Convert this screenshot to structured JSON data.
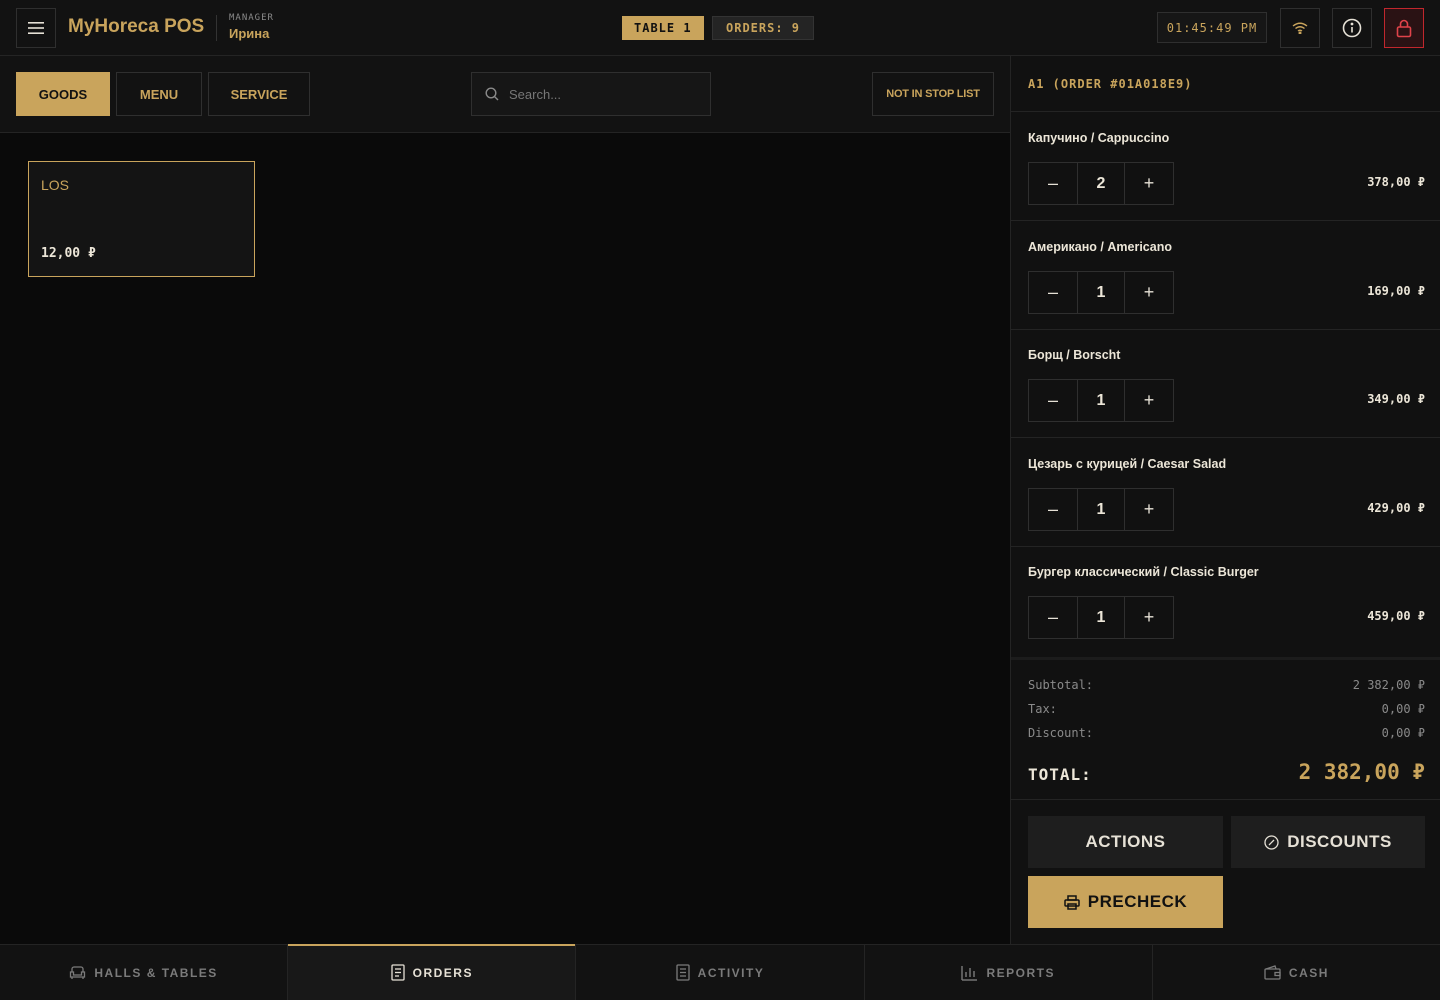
{
  "header": {
    "brand": "MyHoreca POS",
    "role": "MANAGER",
    "user": "Ирина",
    "table_badge": "TABLE 1",
    "orders_badge": "ORDERS: 9",
    "clock": "01:45:49 PM"
  },
  "toolbar": {
    "tabs": [
      {
        "label": "GOODS",
        "active": true
      },
      {
        "label": "MENU",
        "active": false
      },
      {
        "label": "SERVICE",
        "active": false
      }
    ],
    "search_placeholder": "Search...",
    "stoplist_label": "NOT IN STOP LIST"
  },
  "products": [
    {
      "name": "LOS",
      "price": "12,00 ₽"
    }
  ],
  "order": {
    "title": "A1 (ORDER #01A018E9)",
    "items": [
      {
        "name": "Капучино / Cappuccino",
        "qty": "2",
        "price": "378,00 ₽"
      },
      {
        "name": "Американо / Americano",
        "qty": "1",
        "price": "169,00 ₽"
      },
      {
        "name": "Борщ / Borscht",
        "qty": "1",
        "price": "349,00 ₽"
      },
      {
        "name": "Цезарь с курицей / Caesar Salad",
        "qty": "1",
        "price": "429,00 ₽"
      },
      {
        "name": "Бургер классический / Classic Burger",
        "qty": "1",
        "price": "459,00 ₽"
      }
    ],
    "subtotal_label": "Subtotal:",
    "subtotal": "2 382,00 ₽",
    "tax_label": "Tax:",
    "tax": "0,00 ₽",
    "discount_label": "Discount:",
    "discount": "0,00 ₽",
    "total_label": "TOTAL:",
    "total": "2 382,00 ₽",
    "actions_label": "ACTIONS",
    "discounts_label": "DISCOUNTS",
    "precheck_label": "PRECHECK"
  },
  "bottom_nav": [
    {
      "label": "HALLS & TABLES",
      "icon": "sofa-icon",
      "active": false
    },
    {
      "label": "ORDERS",
      "icon": "receipt-icon",
      "active": true
    },
    {
      "label": "ACTIVITY",
      "icon": "document-icon",
      "active": false
    },
    {
      "label": "REPORTS",
      "icon": "bar-chart-icon",
      "active": false
    },
    {
      "label": "CASH",
      "icon": "wallet-icon",
      "active": false
    }
  ],
  "colors": {
    "accent": "#c9a45c",
    "background": "#0a0a0a",
    "panel": "#121212",
    "danger": "#c1272d"
  }
}
